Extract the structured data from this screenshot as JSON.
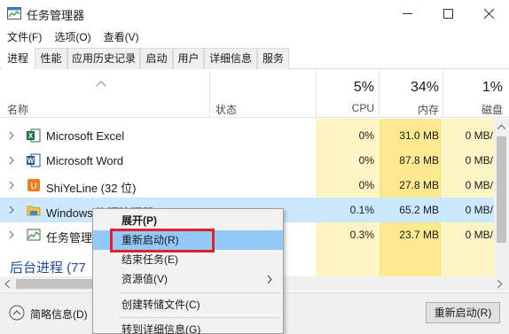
{
  "window": {
    "title": "任务管理器"
  },
  "menu": [
    "文件(F)",
    "选项(O)",
    "查看(V)"
  ],
  "tabs": [
    "进程",
    "性能",
    "应用历史记录",
    "启动",
    "用户",
    "详细信息",
    "服务"
  ],
  "columns": {
    "name": "名称",
    "status": "状态",
    "cpu": {
      "pct": "5%",
      "label": "CPU"
    },
    "mem": {
      "pct": "34%",
      "label": "内存"
    },
    "disk": {
      "pct": "1%",
      "label": "磁盘"
    }
  },
  "rows": [
    {
      "name": "Microsoft Excel",
      "cpu": "0%",
      "mem": "31.0 MB",
      "disk": "0 MB/",
      "icon": "excel-icon"
    },
    {
      "name": "Microsoft Word",
      "cpu": "0%",
      "mem": "87.8 MB",
      "disk": "0 MB/",
      "icon": "word-icon"
    },
    {
      "name": "ShiYeLine (32 位)",
      "cpu": "0%",
      "mem": "27.8 MB",
      "disk": "0 MB/",
      "icon": "shiyeline-icon"
    },
    {
      "name": "Windows 资源管理器",
      "cpu": "0.1%",
      "mem": "65.2 MB",
      "disk": "0 MB/",
      "icon": "folder-icon"
    },
    {
      "name": "任务管理器",
      "cpu": "0.3%",
      "mem": "23.7 MB",
      "disk": "0 MB/",
      "icon": "taskmgr-icon"
    }
  ],
  "group": {
    "title": "后台进程 (77"
  },
  "context_menu": {
    "items": [
      "展开(P)",
      "重新启动(R)",
      "结束任务(E)",
      "资源值(V)",
      "创建转储文件(C)",
      "转到详细信息(G)"
    ]
  },
  "bottom": {
    "brief": "简略信息(D)",
    "restart": "重新启动(R)"
  },
  "colors": {
    "cpu_bg": "#fff4c4",
    "mem_bg": "#fce98f",
    "selected": "#cce8ff",
    "hover": "#91c9f7",
    "highlight_box": "#e0202a"
  }
}
